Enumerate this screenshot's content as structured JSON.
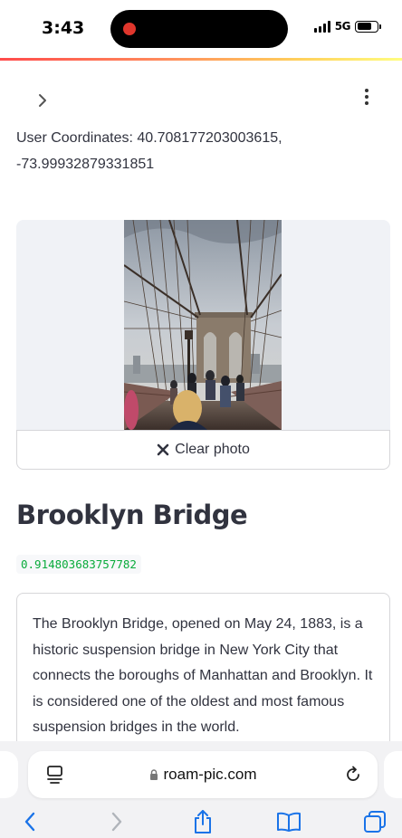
{
  "status_bar": {
    "time": "3:43",
    "network": "5G"
  },
  "app": {
    "coordinates_text": "User Coordinates: 40.708177203003615, -73.99932879331851",
    "clear_photo_label": "Clear photo",
    "place_title": "Brooklyn Bridge",
    "confidence_score": "0.914803683757782",
    "description": "The Brooklyn Bridge, opened on May 24, 1883, is a historic suspension bridge in New York City that connects the boroughs of Manhattan and Brooklyn. It is considered one of the oldest and most famous suspension bridges in the world."
  },
  "browser": {
    "url": "roam-pic.com"
  },
  "icons": {
    "sidebar_toggle": "chevron-right-icon",
    "menu": "more-vertical-icon",
    "clear": "close-icon",
    "page_menu": "page-menu-icon",
    "lock": "lock-icon",
    "reload": "reload-icon",
    "back": "back-icon",
    "forward": "forward-icon",
    "share": "share-icon",
    "bookmarks": "bookmarks-icon",
    "tabs": "tabs-icon"
  },
  "colors": {
    "accent_red": "#ff4b4b",
    "score_green": "#09ab3b",
    "ios_blue": "#1a73e8"
  }
}
